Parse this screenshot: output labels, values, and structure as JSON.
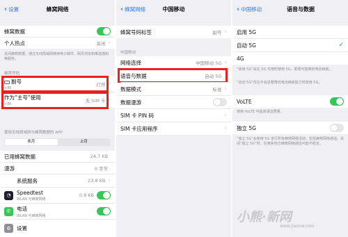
{
  "panel1": {
    "back": "设置",
    "title": "蜂窝网络",
    "cellular_data": "蜂窝数据",
    "hotspot": "个人热点",
    "hotspot_value": "关闭",
    "note": "关闭蜂窝数据，通过无线局域网使用电子邮件、网页浏览和推送通知等服务。",
    "section_numbers": "蜂窝号码",
    "line1_name": "副号",
    "line1_sub": "+86",
    "line1_value": "打开",
    "line2_name": "作为“主号”使用",
    "line2_sub": "+86",
    "line2_value": "无 SIM 卡",
    "section_apps": "使用无线局域网与蜂窝数据的 APP",
    "tab_current": "本月",
    "tab_last": "上月",
    "used_label": "已用蜂窝数据",
    "used_value": "24.7 KB",
    "roaming_label": "漫游",
    "roaming_value": "0 字节",
    "system_label": "系统服务",
    "system_value": "23.8 KB",
    "app1_name": "Speedtest",
    "app1_sub": "WLAN 与蜂窝网络",
    "app1_value": "0.8 KB",
    "app2_name": "电话",
    "app2_sub": "WLAN 与蜂窝网络",
    "app3_name": "设置"
  },
  "panel2": {
    "back": "蜂窝网络",
    "title": "中国移动",
    "line_label": "蜂窝号码标签",
    "line_label_value": "副号",
    "section": "中国移动",
    "network_select": "网络选择",
    "network_select_value": "中国移动 5G",
    "voice_data": "语音与数据",
    "voice_data_value": "自动 5G",
    "data_mode": "数据模式",
    "data_mode_value": "标准",
    "data_roaming": "数据漫游",
    "sim_pin": "SIM 卡 PIN 码",
    "sim_apps": "SIM 卡应用程序"
  },
  "panel3": {
    "back": "中国移动",
    "title": "语音与数据",
    "opt1": "启用 5G",
    "opt2": "自动 5G",
    "opt3": "4G",
    "note1": "“启用 5G”会在 5G 可用时使用 5G，即便可能降低电池续航。",
    "note2": "“自动 5G”仅在不会显著降低电池续航能力时使用 5G。",
    "volte": "VoLTE",
    "volte_note": "使用 VoLTE 可提高语音质量。",
    "sa5g": "独立 5G",
    "sa5g_note": "“独立 5G”会使用 5G 进行所有蜂窝网络活动，包括蜂窝网络通话。关闭“独立 5G”时，在某些地方蜂窝网络通话可能不稳定。"
  },
  "watermark": {
    "brand": "小熊·新网",
    "url": "www.jiaonw.com"
  },
  "colors": {
    "accent": "#2f7cf6",
    "toggle_on": "#34c759",
    "highlight": "#e8201e"
  }
}
